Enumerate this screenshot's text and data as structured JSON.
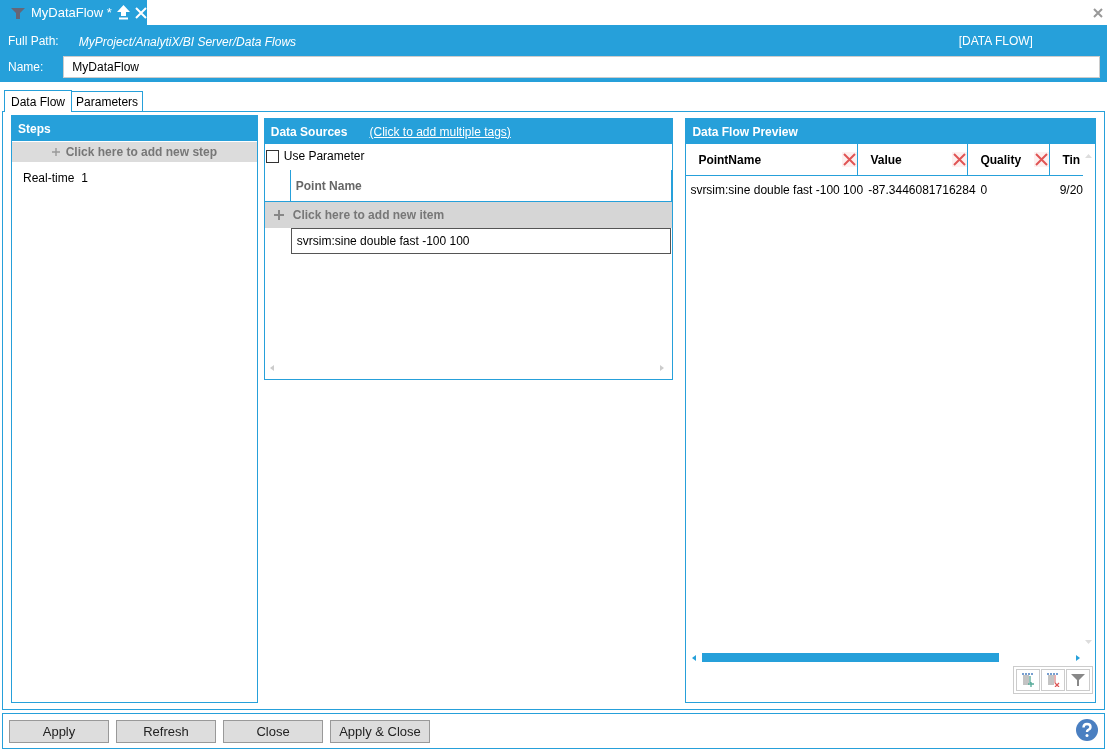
{
  "document_tab": {
    "title": "MyDataFlow *",
    "selected": true
  },
  "header": {
    "full_path_label": "Full Path:",
    "full_path": "MyProject/AnalytiX/BI Server/Data Flows",
    "type_label": "[DATA FLOW]",
    "name_label": "Name:",
    "name_value": "MyDataFlow"
  },
  "tabs": [
    {
      "label": "Data Flow",
      "selected": true
    },
    {
      "label": "Parameters",
      "selected": false
    }
  ],
  "steps": {
    "title": "Steps",
    "add_label": "Click here to add new step",
    "items": [
      {
        "label": "Real-time",
        "count": "1"
      }
    ]
  },
  "data_sources": {
    "title": "Data Sources",
    "link": "(Click to add multiple tags)",
    "use_parameter": {
      "label": "Use Parameter",
      "checked": false
    },
    "column": "Point Name",
    "add_label": "Click here to add new item",
    "rows": [
      "svrsim:sine double fast -100 100"
    ]
  },
  "preview": {
    "title": "Data Flow Preview",
    "columns": [
      {
        "label": "PointName",
        "filter": true
      },
      {
        "label": "Value",
        "filter": true
      },
      {
        "label": "Quality",
        "filter": true
      },
      {
        "label": "Tin",
        "filter": false
      }
    ],
    "rows": [
      [
        "svrsim:sine double fast -100 100",
        "-87.3446081716284",
        "0",
        "9/20"
      ]
    ]
  },
  "buttons": [
    "Apply",
    "Refresh",
    "Close",
    "Apply & Close"
  ]
}
